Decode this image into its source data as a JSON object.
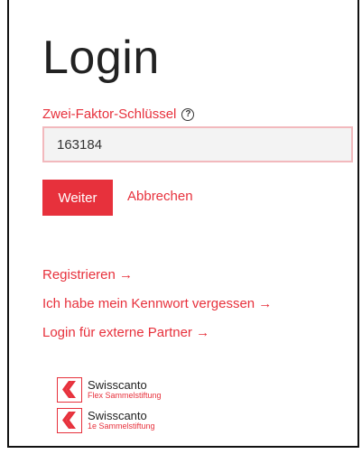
{
  "page": {
    "title": "Login"
  },
  "form": {
    "label": "Zwei-Faktor-Schlüssel",
    "help_icon": "question-circle-icon",
    "input_value": "163184",
    "submit_label": "Weiter",
    "cancel_label": "Abbrechen"
  },
  "links": [
    {
      "label": "Registrieren →"
    },
    {
      "label": "Ich habe mein Kennwort vergessen →"
    },
    {
      "label": "Login für externe Partner →"
    }
  ],
  "brands": [
    {
      "name": "Swisscanto",
      "subtitle": "Flex Sammelstiftung",
      "logo": "swisscanto-logo-icon"
    },
    {
      "name": "Swisscanto",
      "subtitle": "1e Sammelstiftung",
      "logo": "swisscanto-logo-icon"
    }
  ],
  "colors": {
    "accent": "#e7313c",
    "input_border": "#f2b9bd",
    "input_bg": "#f3f3f3",
    "text": "#222222"
  }
}
